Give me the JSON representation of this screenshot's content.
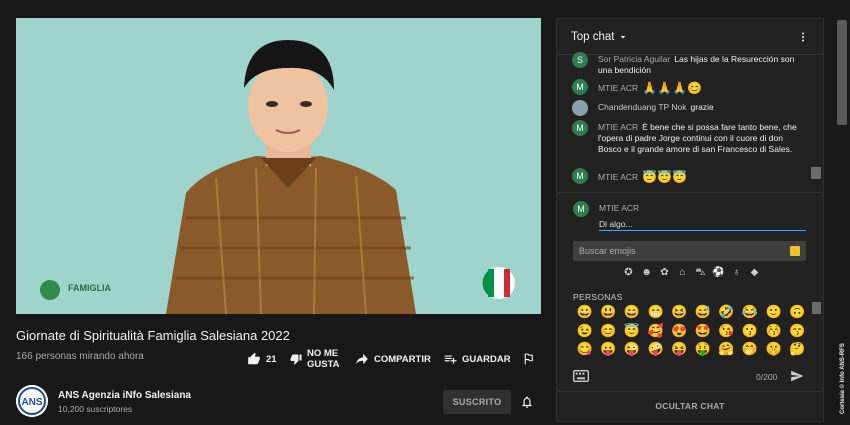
{
  "video": {
    "flag_colors": [
      "#009246",
      "#ffffff",
      "#ce2b37"
    ],
    "overlay_logo": "FAMIGLIA"
  },
  "title": "Giornate di Spiritualità Famiglia Salesiana 2022",
  "viewers": "166 personas mirando ahora",
  "actions": {
    "like_count": "21",
    "dislike_label": "NO ME GUSTA",
    "share_label": "COMPARTIR",
    "save_label": "GUARDAR"
  },
  "channel": {
    "avatar_text": "ANS",
    "name": "ANS Agenzia iNfo Salesiana",
    "subscribers": "10,200 suscriptores",
    "subscribe_label": "SUSCRITO"
  },
  "chat": {
    "header": "Top chat",
    "messages": [
      {
        "avatar": "S",
        "avatar_color": "#2e7d4f",
        "author": "Sor Patricia Aguilar",
        "text": "Las hijas de la Resurección son una bendición"
      },
      {
        "avatar": "M",
        "avatar_color": "#2e7d4f",
        "author": "MTIE ACR",
        "text": "🙏🙏🙏😊"
      },
      {
        "avatar": "",
        "avatar_color": "#8aa0a8",
        "author": "Chandenduang TP Nok",
        "text": "grazie"
      },
      {
        "avatar": "M",
        "avatar_color": "#2e7d4f",
        "author": "MTIE ACR",
        "text": "È bene che si possa fare tanto bene, che l'opera di padre Jorge continui con il cuore di don Bosco e il grande amore di san Francesco di Sales."
      },
      {
        "avatar": "M",
        "avatar_color": "#2e7d4f",
        "author": "MTIE ACR",
        "text": "😇😇😇"
      }
    ],
    "compose_author": "MTIE ACR",
    "compose_avatar": "M",
    "compose_placeholder": "Di algo...",
    "emoji_search_placeholder": "Buscar emojis",
    "category_icons": [
      "✪",
      "☻",
      "✿",
      "⌂",
      "⛍",
      "⚽",
      "♁",
      "◆"
    ],
    "category_label": "PERSONAS",
    "emojis": [
      "😀",
      "😃",
      "😄",
      "😁",
      "😆",
      "😅",
      "🤣",
      "😂",
      "🙂",
      "🙃",
      "😉",
      "😊",
      "😇",
      "🥰",
      "😍",
      "🤩",
      "😘",
      "😗",
      "😚",
      "😙",
      "😋",
      "😛",
      "😜",
      "🤪",
      "😝",
      "🤑",
      "🤗",
      "🤭",
      "🤫",
      "🤔"
    ],
    "counter": "0/200",
    "hide_label": "OCULTAR CHAT"
  },
  "credit": "Cortesía © Info ANS-RFS"
}
